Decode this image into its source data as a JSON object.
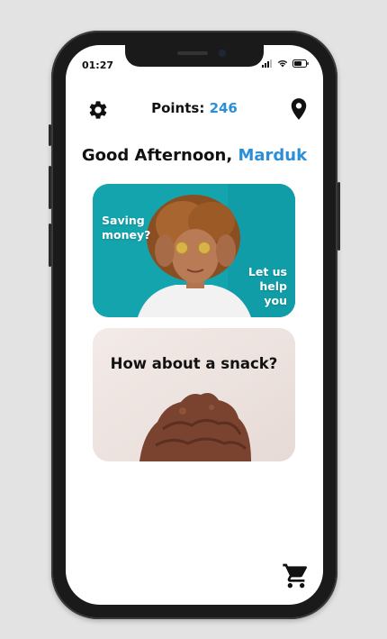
{
  "status_bar": {
    "time": "01:27"
  },
  "header": {
    "points_label": "Points:",
    "points_value": "246",
    "settings_icon": "gear-icon",
    "location_icon": "map-pin-icon"
  },
  "greeting": {
    "text": "Good Afternoon,",
    "name": "Marduk"
  },
  "cards": {
    "saving": {
      "left_text": "Saving money?",
      "right_text": "Let us help you"
    },
    "snack": {
      "title": "How about a snack?"
    }
  },
  "cart_icon": "shopping-cart-icon",
  "colors": {
    "accent": "#2a8fd8",
    "saving_card_bg": "#1aa7b0",
    "snack_card_bg": "#f0e6e3"
  }
}
